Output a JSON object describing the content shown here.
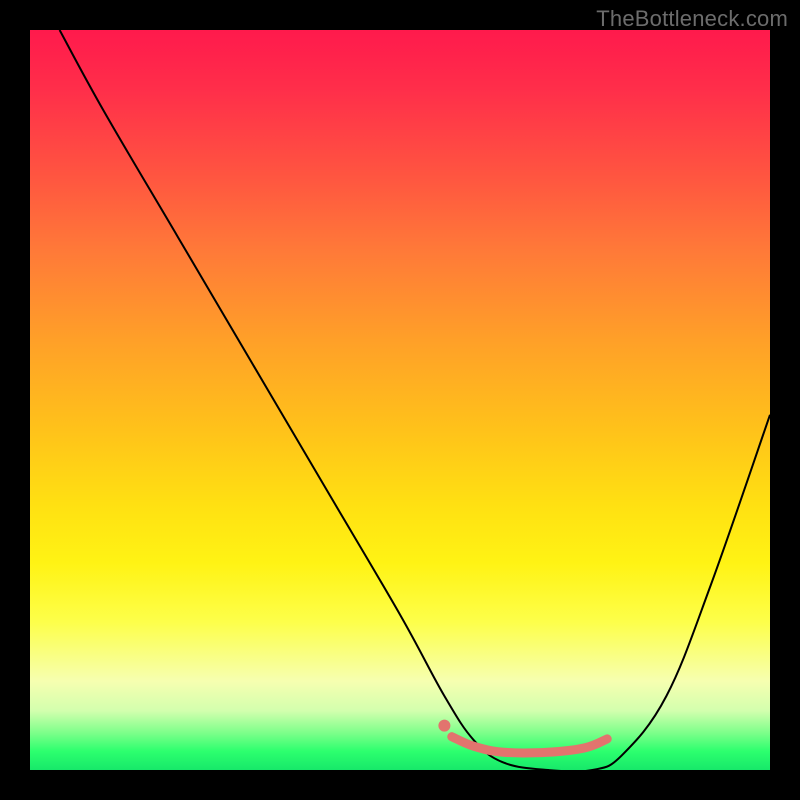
{
  "watermark": "TheBottleneck.com",
  "chart_data": {
    "type": "line",
    "title": "",
    "xlabel": "",
    "ylabel": "",
    "x_range": [
      0,
      100
    ],
    "y_range": [
      0,
      100
    ],
    "grid": false,
    "legend": false,
    "gradient_stops": [
      {
        "pos": 0,
        "color": "#ff1a4c"
      },
      {
        "pos": 8,
        "color": "#ff2e4a"
      },
      {
        "pos": 20,
        "color": "#ff5640"
      },
      {
        "pos": 30,
        "color": "#ff7a38"
      },
      {
        "pos": 42,
        "color": "#ffa028"
      },
      {
        "pos": 54,
        "color": "#ffc21a"
      },
      {
        "pos": 64,
        "color": "#ffe012"
      },
      {
        "pos": 72,
        "color": "#fff314"
      },
      {
        "pos": 80,
        "color": "#fdff4a"
      },
      {
        "pos": 88,
        "color": "#f6ffb0"
      },
      {
        "pos": 92,
        "color": "#d3ffae"
      },
      {
        "pos": 95,
        "color": "#7cff8a"
      },
      {
        "pos": 97.5,
        "color": "#2cff6e"
      },
      {
        "pos": 100,
        "color": "#17e86a"
      }
    ],
    "series": [
      {
        "name": "bottleneck-curve",
        "color": "#000000",
        "stroke_width": 2,
        "x": [
          4,
          10,
          20,
          30,
          40,
          50,
          56,
          60,
          64,
          70,
          76,
          80,
          86,
          92,
          100
        ],
        "y_top0": [
          100,
          89,
          72,
          55,
          38,
          21,
          10,
          4,
          1,
          0,
          0,
          2,
          10,
          25,
          48
        ]
      }
    ],
    "highlight_band": {
      "name": "optimal-range",
      "color": "#e2746e",
      "stroke_width": 9,
      "linecap": "round",
      "x": [
        57,
        60,
        64,
        70,
        75,
        78
      ],
      "y_top0": [
        4.5,
        3.2,
        2.4,
        2.4,
        3.0,
        4.2
      ]
    },
    "highlight_dot": {
      "name": "current-config",
      "color": "#e2746e",
      "radius": 6,
      "x": 56,
      "y_top0": 6
    }
  }
}
